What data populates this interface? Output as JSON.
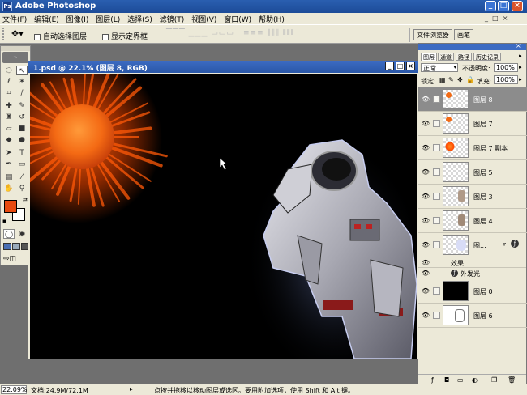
{
  "app": {
    "title": "Adobe Photoshop"
  },
  "menu": [
    "文件(F)",
    "编辑(E)",
    "图像(I)",
    "图层(L)",
    "选择(S)",
    "滤镜(T)",
    "视图(V)",
    "窗口(W)",
    "帮助(H)"
  ],
  "options": {
    "auto_select": "自动选择图层",
    "show_bounds": "显示定界框"
  },
  "palette_well": {
    "tabs": [
      "文件浏览器",
      "画笔"
    ]
  },
  "document": {
    "title": "1.psd @ 22.1% (图层 8, RGB)"
  },
  "layers_panel": {
    "tabs": [
      "图层",
      "通道",
      "路径",
      "历史记录"
    ],
    "blend_mode": "正常",
    "opacity_label": "不透明度:",
    "opacity": "100%",
    "lock_label": "锁定:",
    "fill_label": "填充:",
    "fill": "100%",
    "layers": [
      {
        "name": "图层 8",
        "thumb": "sun-small"
      },
      {
        "name": "图层 7",
        "thumb": "sun-small"
      },
      {
        "name": "图层 7 副本",
        "thumb": "sun"
      },
      {
        "name": "图层 5",
        "thumb": "empty"
      },
      {
        "name": "图层 3",
        "thumb": "figure"
      },
      {
        "name": "图层 4",
        "thumb": "figure"
      },
      {
        "name": "图...",
        "thumb": "glow"
      }
    ],
    "effects_label": "效果",
    "effect_name": "外发光",
    "bottom_layers": [
      {
        "name": "图层 0",
        "thumb": "black"
      },
      {
        "name": "图层 6",
        "thumb": "sketch"
      }
    ]
  },
  "status": {
    "zoom": "22.09%",
    "doc_size": "文档:24.9M/72.1M",
    "hint": "点按并拖移以移动图层或选区。要用附加选项，使用 Shift 和 Alt 键。"
  },
  "colors": {
    "foreground": "#e84a10",
    "background": "#ffffff",
    "titlebar": "#2a5fb0",
    "selected_layer": "#8c8c8c"
  }
}
